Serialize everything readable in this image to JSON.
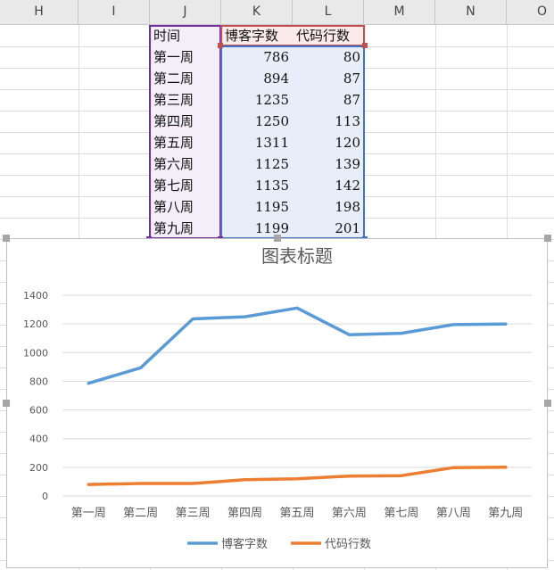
{
  "columns": [
    "H",
    "I",
    "J",
    "K",
    "L",
    "M",
    "N",
    "O"
  ],
  "table": {
    "headers": [
      "时间",
      "博客字数",
      "代码行数"
    ],
    "rows": [
      [
        "第一周",
        "786",
        "80"
      ],
      [
        "第二周",
        "894",
        "87"
      ],
      [
        "第三周",
        "1235",
        "87"
      ],
      [
        "第四周",
        "1250",
        "113"
      ],
      [
        "第五周",
        "1311",
        "120"
      ],
      [
        "第六周",
        "1125",
        "139"
      ],
      [
        "第七周",
        "1135",
        "142"
      ],
      [
        "第八周",
        "1195",
        "198"
      ],
      [
        "第九周",
        "1199",
        "201"
      ]
    ]
  },
  "colors": {
    "series_blue": "#5b9bd5",
    "series_orange": "#ed7d31",
    "header_bg": "#e9e9e9",
    "range_purple": "#7030a0",
    "range_red": "#c0504d",
    "range_blue": "#4472c4"
  },
  "chart_data": {
    "type": "line",
    "title": "图表标题",
    "categories": [
      "第一周",
      "第二周",
      "第三周",
      "第四周",
      "第五周",
      "第六周",
      "第七周",
      "第八周",
      "第九周"
    ],
    "series": [
      {
        "name": "博客字数",
        "color": "#5b9bd5",
        "values": [
          786,
          894,
          1235,
          1250,
          1311,
          1125,
          1135,
          1195,
          1199
        ]
      },
      {
        "name": "代码行数",
        "color": "#ed7d31",
        "values": [
          80,
          87,
          87,
          113,
          120,
          139,
          142,
          198,
          201
        ]
      }
    ],
    "ylim": [
      0,
      1400
    ],
    "yticks": [
      "0",
      "200",
      "400",
      "600",
      "800",
      "1000",
      "1200",
      "1400"
    ],
    "grid": true,
    "legend": "bottom"
  }
}
